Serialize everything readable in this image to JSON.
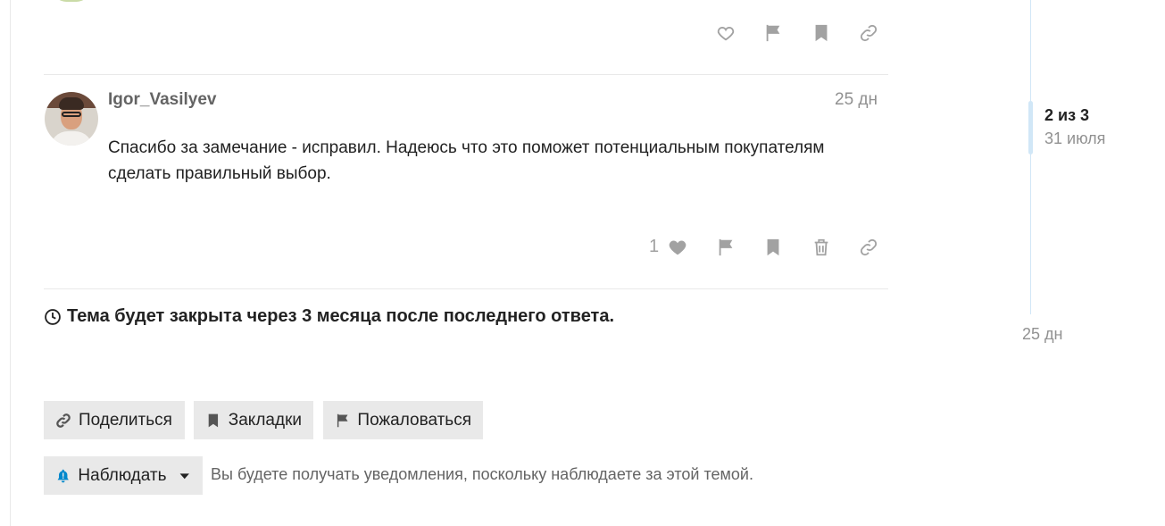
{
  "post": {
    "username": "Igor_Vasilyev",
    "date": "25 дн",
    "body": "Спасибо за замечание - исправил. Надеюсь что это поможет потенциальным покупателям сделать правильный выбор.",
    "like_count": "1"
  },
  "icons": {
    "like": "heart-icon",
    "flag": "flag-icon",
    "bookmark": "bookmark-icon",
    "delete": "trash-icon",
    "link": "link-icon",
    "clock": "clock-icon",
    "bell": "bell-icon",
    "caret": "caret-down-icon"
  },
  "topic": {
    "closing_notice": "Тема будет закрыта через 3 месяца после последнего ответа."
  },
  "footer": {
    "share_label": "Поделиться",
    "bookmark_label": "Закладки",
    "flag_label": "Пожаловаться",
    "watch_label": "Наблюдать",
    "notification_text": "Вы будете получать уведомления, поскольку наблюдаете за этой темой."
  },
  "timeline": {
    "position": "2 из 3",
    "position_date": "31 июля",
    "end_date": "25 дн"
  },
  "colors": {
    "accent": "#0088cc",
    "timeline": "#d1e7f7",
    "button_bg": "#e9e9e9",
    "muted": "#919191"
  }
}
